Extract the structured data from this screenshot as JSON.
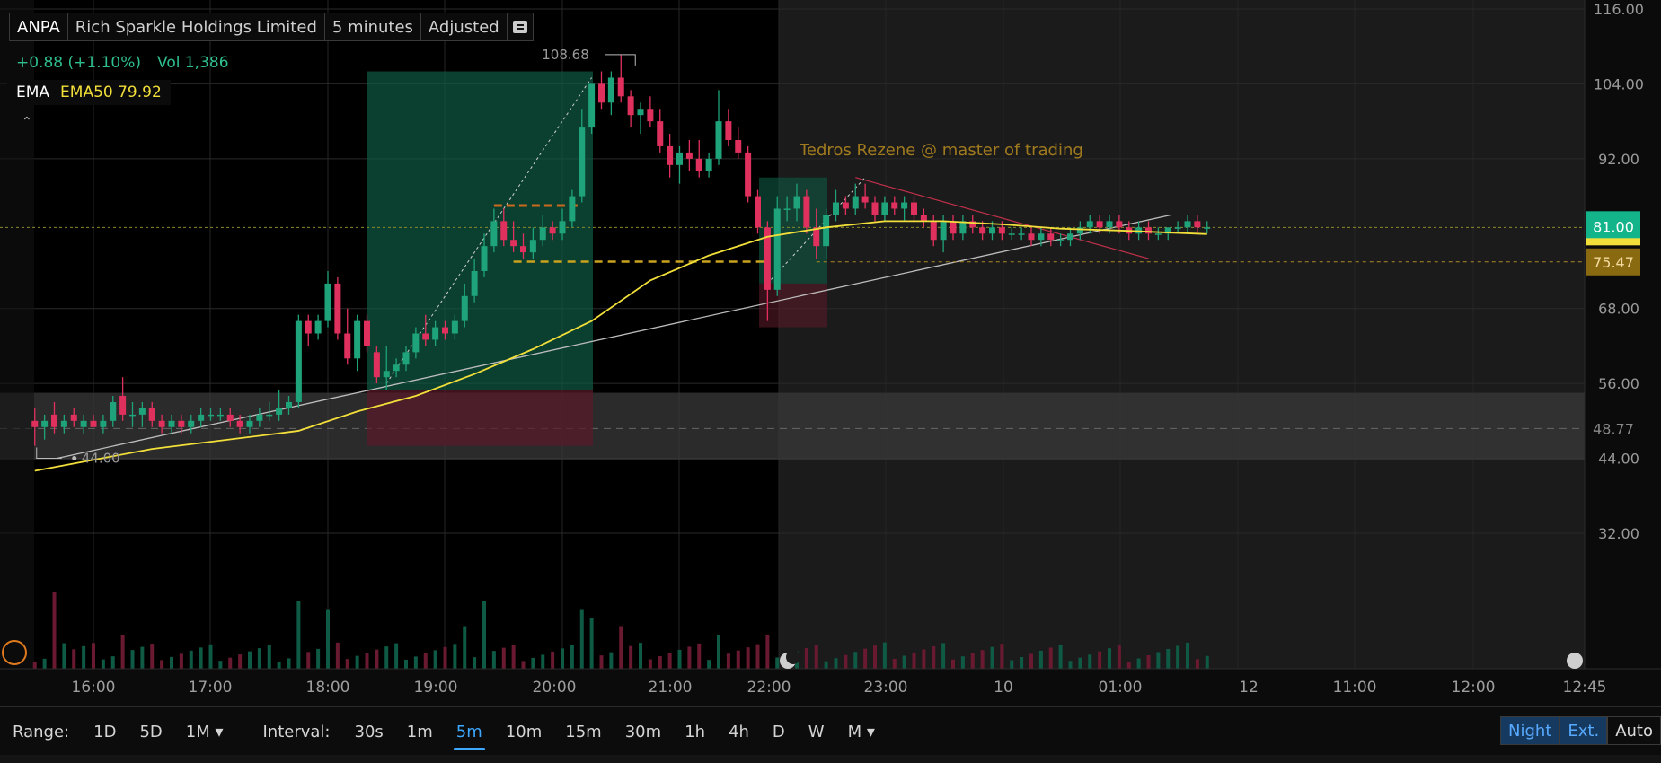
{
  "header": {
    "symbol": "ANPA",
    "company": "Rich Sparkle Holdings Limited",
    "timeframe": "5 minutes",
    "adjustment": "Adjusted"
  },
  "quote": {
    "change": "+0.88 (+1.10%)",
    "volume_label": "Vol",
    "volume": "1,386"
  },
  "indicator": {
    "name": "EMA",
    "value": "EMA50 79.92"
  },
  "colors": {
    "up": "#1fa37a",
    "down": "#e0315e",
    "ema": "#f2df3a",
    "price_tag": "#14b48a",
    "level_tag": "#8a6a10",
    "accent": "#3da8ff"
  },
  "annotation": "Tedros Rezene @ master of trading",
  "chart_data": {
    "type": "candlestick",
    "ylim": [
      26,
      118
    ],
    "y_ticks": [
      116.0,
      104.0,
      92.0,
      81.0,
      75.47,
      68.0,
      56.0,
      48.77,
      44.0,
      32.0
    ],
    "y_tick_labels": [
      "116.00",
      "104.00",
      "92.00",
      "81.00",
      "75.47",
      "68.00",
      "56.00",
      "48.77",
      "44.00",
      "32.00"
    ],
    "x_tick_labels": [
      "16:00",
      "17:00",
      "18:00",
      "19:00",
      "20:00",
      "21:00",
      "22:00",
      "23:00",
      "10",
      "01:00",
      "11:00",
      "12",
      "11:00",
      "12:00",
      "12:45"
    ],
    "x_tick_times": [
      "16:00",
      "17:00",
      "18:00",
      "19:00",
      "20:00",
      "21:00",
      "22:00",
      "23:00",
      "00:00",
      "01:00",
      "",
      "",
      "",
      "",
      ""
    ],
    "x_tick_labels_visible": [
      "16:00",
      "17:00",
      "18:00",
      "19:00",
      "20:00",
      "21:00",
      "22:00",
      "23:00",
      "10",
      "01:00",
      "12",
      "11:00",
      "12:00",
      "12:45"
    ],
    "last_price": 81.0,
    "last_price_label": "81.00",
    "level_price": 75.47,
    "level_label": "75.47",
    "range_mid_label": "48.77",
    "high_marker": 108.68,
    "high_marker_label": "108.68",
    "low_marker": 44.0,
    "low_marker_label": "44.00",
    "series": [
      {
        "name": "EMA50",
        "last": 79.92
      }
    ],
    "candles": [
      {
        "t": "15:30",
        "o": 50,
        "h": 52,
        "l": 46,
        "c": 49
      },
      {
        "t": "15:35",
        "o": 49,
        "h": 51,
        "l": 47,
        "c": 50
      },
      {
        "t": "15:40",
        "o": 51,
        "h": 53,
        "l": 48,
        "c": 49
      },
      {
        "t": "15:45",
        "o": 49,
        "h": 51,
        "l": 48,
        "c": 50
      },
      {
        "t": "15:50",
        "o": 51,
        "h": 52,
        "l": 49,
        "c": 50
      },
      {
        "t": "15:55",
        "o": 49,
        "h": 51,
        "l": 48,
        "c": 50
      },
      {
        "t": "16:00",
        "o": 50,
        "h": 51,
        "l": 49,
        "c": 49
      },
      {
        "t": "16:05",
        "o": 49,
        "h": 51,
        "l": 48,
        "c": 50
      },
      {
        "t": "16:10",
        "o": 50,
        "h": 54,
        "l": 49,
        "c": 53
      },
      {
        "t": "16:15",
        "o": 54,
        "h": 57,
        "l": 50,
        "c": 51
      },
      {
        "t": "16:20",
        "o": 51,
        "h": 53,
        "l": 49,
        "c": 51
      },
      {
        "t": "16:25",
        "o": 51,
        "h": 53,
        "l": 49,
        "c": 52
      },
      {
        "t": "16:30",
        "o": 52,
        "h": 53,
        "l": 49,
        "c": 50
      },
      {
        "t": "16:35",
        "o": 50,
        "h": 51,
        "l": 48,
        "c": 49
      },
      {
        "t": "16:40",
        "o": 49,
        "h": 51,
        "l": 48,
        "c": 50
      },
      {
        "t": "16:45",
        "o": 50,
        "h": 51,
        "l": 48,
        "c": 49
      },
      {
        "t": "16:50",
        "o": 49,
        "h": 51,
        "l": 48,
        "c": 50
      },
      {
        "t": "16:55",
        "o": 50,
        "h": 52,
        "l": 49,
        "c": 51
      },
      {
        "t": "17:00",
        "o": 51,
        "h": 52,
        "l": 50,
        "c": 51
      },
      {
        "t": "17:05",
        "o": 51,
        "h": 52,
        "l": 50,
        "c": 51
      },
      {
        "t": "17:10",
        "o": 51,
        "h": 52,
        "l": 49,
        "c": 50
      },
      {
        "t": "17:15",
        "o": 50,
        "h": 51,
        "l": 48,
        "c": 49
      },
      {
        "t": "17:20",
        "o": 49,
        "h": 51,
        "l": 48,
        "c": 50
      },
      {
        "t": "17:25",
        "o": 50,
        "h": 52,
        "l": 49,
        "c": 51
      },
      {
        "t": "17:30",
        "o": 51,
        "h": 53,
        "l": 50,
        "c": 51
      },
      {
        "t": "17:35",
        "o": 51,
        "h": 55,
        "l": 50,
        "c": 52
      },
      {
        "t": "17:40",
        "o": 52,
        "h": 54,
        "l": 51,
        "c": 53
      },
      {
        "t": "17:45",
        "o": 53,
        "h": 67,
        "l": 52,
        "c": 66
      },
      {
        "t": "17:50",
        "o": 66,
        "h": 67,
        "l": 62,
        "c": 64
      },
      {
        "t": "17:55",
        "o": 64,
        "h": 67,
        "l": 63,
        "c": 66
      },
      {
        "t": "18:00",
        "o": 66,
        "h": 74,
        "l": 65,
        "c": 72
      },
      {
        "t": "18:05",
        "o": 72,
        "h": 73,
        "l": 63,
        "c": 64
      },
      {
        "t": "18:10",
        "o": 64,
        "h": 68,
        "l": 59,
        "c": 60
      },
      {
        "t": "18:15",
        "o": 60,
        "h": 67,
        "l": 58,
        "c": 66
      },
      {
        "t": "18:20",
        "o": 66,
        "h": 67,
        "l": 61,
        "c": 62
      },
      {
        "t": "18:25",
        "o": 61,
        "h": 62,
        "l": 56,
        "c": 57
      },
      {
        "t": "18:30",
        "o": 57,
        "h": 62,
        "l": 55,
        "c": 58
      },
      {
        "t": "18:35",
        "o": 58,
        "h": 60,
        "l": 57,
        "c": 59
      },
      {
        "t": "18:40",
        "o": 59,
        "h": 62,
        "l": 58,
        "c": 61
      },
      {
        "t": "18:45",
        "o": 61,
        "h": 65,
        "l": 60,
        "c": 64
      },
      {
        "t": "18:50",
        "o": 64,
        "h": 67,
        "l": 62,
        "c": 63
      },
      {
        "t": "18:55",
        "o": 63,
        "h": 66,
        "l": 62,
        "c": 65
      },
      {
        "t": "19:00",
        "o": 65,
        "h": 66,
        "l": 63,
        "c": 64
      },
      {
        "t": "19:05",
        "o": 64,
        "h": 67,
        "l": 63,
        "c": 66
      },
      {
        "t": "19:10",
        "o": 66,
        "h": 72,
        "l": 65,
        "c": 70
      },
      {
        "t": "19:15",
        "o": 70,
        "h": 76,
        "l": 69,
        "c": 74
      },
      {
        "t": "19:20",
        "o": 74,
        "h": 80,
        "l": 73,
        "c": 78
      },
      {
        "t": "19:25",
        "o": 78,
        "h": 84,
        "l": 77,
        "c": 82
      },
      {
        "t": "19:30",
        "o": 82,
        "h": 84,
        "l": 78,
        "c": 79
      },
      {
        "t": "19:35",
        "o": 79,
        "h": 82,
        "l": 77,
        "c": 78
      },
      {
        "t": "19:40",
        "o": 78,
        "h": 80,
        "l": 76,
        "c": 77
      },
      {
        "t": "19:45",
        "o": 77,
        "h": 81,
        "l": 76,
        "c": 79
      },
      {
        "t": "19:50",
        "o": 79,
        "h": 83,
        "l": 78,
        "c": 81
      },
      {
        "t": "19:55",
        "o": 81,
        "h": 82,
        "l": 79,
        "c": 80
      },
      {
        "t": "20:00",
        "o": 80,
        "h": 84,
        "l": 79,
        "c": 82
      },
      {
        "t": "20:05",
        "o": 82,
        "h": 87,
        "l": 81,
        "c": 86
      },
      {
        "t": "20:10",
        "o": 86,
        "h": 100,
        "l": 85,
        "c": 97
      },
      {
        "t": "20:15",
        "o": 97,
        "h": 104,
        "l": 96,
        "c": 104
      },
      {
        "t": "20:20",
        "o": 104,
        "h": 106,
        "l": 100,
        "c": 101
      },
      {
        "t": "20:25",
        "o": 101,
        "h": 106,
        "l": 99,
        "c": 105
      },
      {
        "t": "20:30",
        "o": 105,
        "h": 108.68,
        "l": 101,
        "c": 102
      },
      {
        "t": "20:35",
        "o": 102,
        "h": 103,
        "l": 97,
        "c": 99
      },
      {
        "t": "20:40",
        "o": 99,
        "h": 101,
        "l": 96,
        "c": 100
      },
      {
        "t": "20:45",
        "o": 100,
        "h": 102,
        "l": 97,
        "c": 98
      },
      {
        "t": "20:50",
        "o": 98,
        "h": 100,
        "l": 93,
        "c": 94
      },
      {
        "t": "20:55",
        "o": 94,
        "h": 96,
        "l": 89,
        "c": 91
      },
      {
        "t": "21:00",
        "o": 91,
        "h": 94,
        "l": 88,
        "c": 93
      },
      {
        "t": "21:05",
        "o": 93,
        "h": 95,
        "l": 90,
        "c": 92
      },
      {
        "t": "21:10",
        "o": 92,
        "h": 95,
        "l": 89,
        "c": 90
      },
      {
        "t": "21:15",
        "o": 90,
        "h": 93,
        "l": 89,
        "c": 92
      },
      {
        "t": "21:20",
        "o": 92,
        "h": 103,
        "l": 91,
        "c": 98
      },
      {
        "t": "21:25",
        "o": 98,
        "h": 100,
        "l": 94,
        "c": 95
      },
      {
        "t": "21:30",
        "o": 95,
        "h": 97,
        "l": 92,
        "c": 93
      },
      {
        "t": "21:35",
        "o": 93,
        "h": 94,
        "l": 85,
        "c": 86
      },
      {
        "t": "21:40",
        "o": 86,
        "h": 87,
        "l": 80,
        "c": 81
      },
      {
        "t": "21:45",
        "o": 81,
        "h": 82,
        "l": 66,
        "c": 71
      },
      {
        "t": "21:50",
        "o": 71,
        "h": 86,
        "l": 70,
        "c": 84
      },
      {
        "t": "21:55",
        "o": 84,
        "h": 86,
        "l": 82,
        "c": 84
      },
      {
        "t": "22:00",
        "o": 84,
        "h": 88,
        "l": 82,
        "c": 86
      },
      {
        "t": "22:05",
        "o": 86,
        "h": 87,
        "l": 80,
        "c": 81
      },
      {
        "t": "22:10",
        "o": 81,
        "h": 84,
        "l": 76,
        "c": 78
      },
      {
        "t": "22:15",
        "o": 78,
        "h": 84,
        "l": 76,
        "c": 83
      },
      {
        "t": "22:20",
        "o": 83,
        "h": 87,
        "l": 82,
        "c": 85
      },
      {
        "t": "22:25",
        "o": 85,
        "h": 86,
        "l": 83,
        "c": 84
      },
      {
        "t": "22:30",
        "o": 84,
        "h": 88,
        "l": 83,
        "c": 86
      },
      {
        "t": "22:35",
        "o": 86,
        "h": 88,
        "l": 84,
        "c": 85
      },
      {
        "t": "22:40",
        "o": 85,
        "h": 86,
        "l": 82,
        "c": 83
      },
      {
        "t": "22:45",
        "o": 83,
        "h": 86,
        "l": 82,
        "c": 85
      },
      {
        "t": "22:50",
        "o": 85,
        "h": 86,
        "l": 83,
        "c": 84
      },
      {
        "t": "22:55",
        "o": 84,
        "h": 86,
        "l": 82,
        "c": 85
      },
      {
        "t": "23:00",
        "o": 85,
        "h": 86,
        "l": 82,
        "c": 83
      },
      {
        "t": "23:05",
        "o": 83,
        "h": 84,
        "l": 81,
        "c": 82
      },
      {
        "t": "23:10",
        "o": 82,
        "h": 83,
        "l": 78,
        "c": 79
      },
      {
        "t": "23:15",
        "o": 79,
        "h": 83,
        "l": 77,
        "c": 82
      },
      {
        "t": "23:20",
        "o": 82,
        "h": 83,
        "l": 79,
        "c": 80
      },
      {
        "t": "23:25",
        "o": 80,
        "h": 83,
        "l": 79,
        "c": 82
      },
      {
        "t": "23:30",
        "o": 82,
        "h": 83,
        "l": 80,
        "c": 81
      },
      {
        "t": "23:35",
        "o": 81,
        "h": 82,
        "l": 79,
        "c": 80
      },
      {
        "t": "23:40",
        "o": 80,
        "h": 82,
        "l": 79,
        "c": 81
      },
      {
        "t": "23:45",
        "o": 81,
        "h": 82,
        "l": 79,
        "c": 80
      },
      {
        "t": "23:50",
        "o": 80,
        "h": 81,
        "l": 79,
        "c": 80
      },
      {
        "t": "23:55",
        "o": 80,
        "h": 81,
        "l": 79,
        "c": 80
      },
      {
        "t": "00:00",
        "o": 80,
        "h": 81,
        "l": 78,
        "c": 79
      },
      {
        "t": "00:05",
        "o": 79,
        "h": 81,
        "l": 78,
        "c": 80
      },
      {
        "t": "00:10",
        "o": 80,
        "h": 81,
        "l": 78,
        "c": 79
      },
      {
        "t": "00:15",
        "o": 79,
        "h": 80,
        "l": 78,
        "c": 79
      },
      {
        "t": "00:20",
        "o": 79,
        "h": 81,
        "l": 78,
        "c": 80
      },
      {
        "t": "00:25",
        "o": 80,
        "h": 82,
        "l": 79,
        "c": 81
      },
      {
        "t": "00:30",
        "o": 81,
        "h": 83,
        "l": 80,
        "c": 82
      },
      {
        "t": "00:35",
        "o": 82,
        "h": 83,
        "l": 80,
        "c": 81
      },
      {
        "t": "00:40",
        "o": 81,
        "h": 83,
        "l": 80,
        "c": 82
      },
      {
        "t": "00:45",
        "o": 82,
        "h": 83,
        "l": 80,
        "c": 81
      },
      {
        "t": "00:50",
        "o": 81,
        "h": 82,
        "l": 79,
        "c": 80
      },
      {
        "t": "00:55",
        "o": 80,
        "h": 82,
        "l": 79,
        "c": 81
      },
      {
        "t": "01:00",
        "o": 81,
        "h": 82,
        "l": 79,
        "c": 80
      },
      {
        "t": "01:05",
        "o": 80,
        "h": 81,
        "l": 79,
        "c": 80
      },
      {
        "t": "01:10",
        "o": 80,
        "h": 81,
        "l": 79,
        "c": 81
      },
      {
        "t": "01:15",
        "o": 81,
        "h": 82,
        "l": 80,
        "c": 81
      },
      {
        "t": "01:20",
        "o": 81,
        "h": 83,
        "l": 80,
        "c": 82
      },
      {
        "t": "01:25",
        "o": 82,
        "h": 83,
        "l": 80,
        "c": 81
      },
      {
        "t": "01:30",
        "o": 81,
        "h": 82,
        "l": 80,
        "c": 81
      }
    ],
    "ema50": [
      {
        "t": "15:30",
        "v": 42.0
      },
      {
        "t": "16:30",
        "v": 45.5
      },
      {
        "t": "17:30",
        "v": 47.8
      },
      {
        "t": "17:45",
        "v": 48.4
      },
      {
        "t": "18:15",
        "v": 51.5
      },
      {
        "t": "18:45",
        "v": 54.0
      },
      {
        "t": "19:15",
        "v": 57.5
      },
      {
        "t": "19:45",
        "v": 61.5
      },
      {
        "t": "20:15",
        "v": 66.0
      },
      {
        "t": "20:45",
        "v": 72.5
      },
      {
        "t": "21:15",
        "v": 76.5
      },
      {
        "t": "21:45",
        "v": 79.5
      },
      {
        "t": "22:15",
        "v": 81.0
      },
      {
        "t": "22:45",
        "v": 82.0
      },
      {
        "t": "23:15",
        "v": 82.0
      },
      {
        "t": "23:45",
        "v": 81.5
      },
      {
        "t": "00:15",
        "v": 80.8
      },
      {
        "t": "00:45",
        "v": 80.5
      },
      {
        "t": "01:30",
        "v": 79.92
      }
    ],
    "volume_bars": [
      {
        "t": "15:40",
        "v": 900,
        "dir": "up"
      },
      {
        "t": "15:45",
        "v": 300,
        "dir": "down"
      },
      {
        "t": "16:15",
        "v": 400,
        "dir": "down"
      },
      {
        "t": "17:45",
        "v": 800,
        "dir": "up"
      },
      {
        "t": "18:00",
        "v": 700,
        "dir": "down"
      },
      {
        "t": "19:10",
        "v": 500,
        "dir": "up"
      },
      {
        "t": "19:20",
        "v": 800,
        "dir": "up"
      },
      {
        "t": "20:10",
        "v": 700,
        "dir": "up"
      },
      {
        "t": "20:15",
        "v": 600,
        "dir": "down"
      },
      {
        "t": "20:30",
        "v": 500,
        "dir": "down"
      },
      {
        "t": "21:20",
        "v": 400,
        "dir": "down"
      },
      {
        "t": "21:45",
        "v": 400,
        "dir": "up"
      }
    ]
  },
  "bottom_bar": {
    "range_label": "Range:",
    "ranges": [
      "1D",
      "5D",
      "1M ▾"
    ],
    "interval_label": "Interval:",
    "intervals": [
      "30s",
      "1m",
      "5m",
      "10m",
      "15m",
      "30m",
      "1h",
      "4h",
      "D",
      "W",
      "M ▾"
    ],
    "active_interval": "5m",
    "session_buttons": [
      "Night",
      "Ext.",
      "Auto"
    ]
  }
}
